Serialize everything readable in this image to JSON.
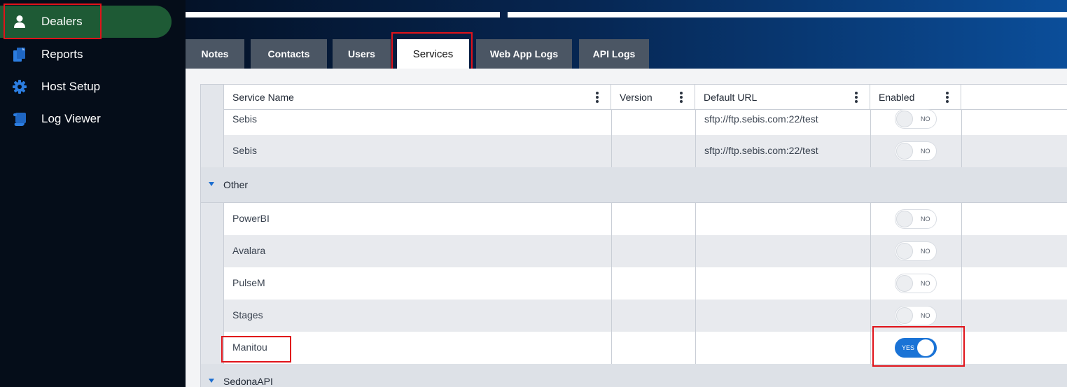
{
  "sidebar": {
    "items": [
      {
        "label": "Dealers",
        "icon": "user-icon",
        "active": true
      },
      {
        "label": "Reports",
        "icon": "documents-icon"
      },
      {
        "label": "Host Setup",
        "icon": "gear-icon"
      },
      {
        "label": "Log Viewer",
        "icon": "scroll-icon"
      }
    ]
  },
  "tabs": [
    "Notes",
    "Contacts",
    "Users",
    "Services",
    "Web App Logs",
    "API Logs"
  ],
  "active_tab": "Services",
  "grid": {
    "columns": [
      "Service Name",
      "Version",
      "Default URL",
      "Enabled"
    ],
    "rows_top": [
      {
        "name": "Sebis",
        "version": "",
        "url": "sftp://ftp.sebis.com:22/test",
        "enabled": "NO"
      },
      {
        "name": "Sebis",
        "version": "",
        "url": "sftp://ftp.sebis.com:22/test",
        "enabled": "NO"
      }
    ],
    "group_other": "Other",
    "rows_other": [
      {
        "name": "PowerBI",
        "version": "",
        "url": "",
        "enabled": "NO"
      },
      {
        "name": "Avalara",
        "version": "",
        "url": "",
        "enabled": "NO"
      },
      {
        "name": "PulseM",
        "version": "",
        "url": "",
        "enabled": "NO"
      },
      {
        "name": "Stages",
        "version": "",
        "url": "",
        "enabled": "NO"
      },
      {
        "name": "Manitou",
        "version": "",
        "url": "",
        "enabled": "YES"
      }
    ],
    "group_sedona": "SedonaAPI"
  },
  "colors": {
    "sidebar_bg": "#050d19",
    "active_nav": "#1e5a35",
    "highlight": "#e0131a",
    "toggle_on": "#1a73d6"
  }
}
